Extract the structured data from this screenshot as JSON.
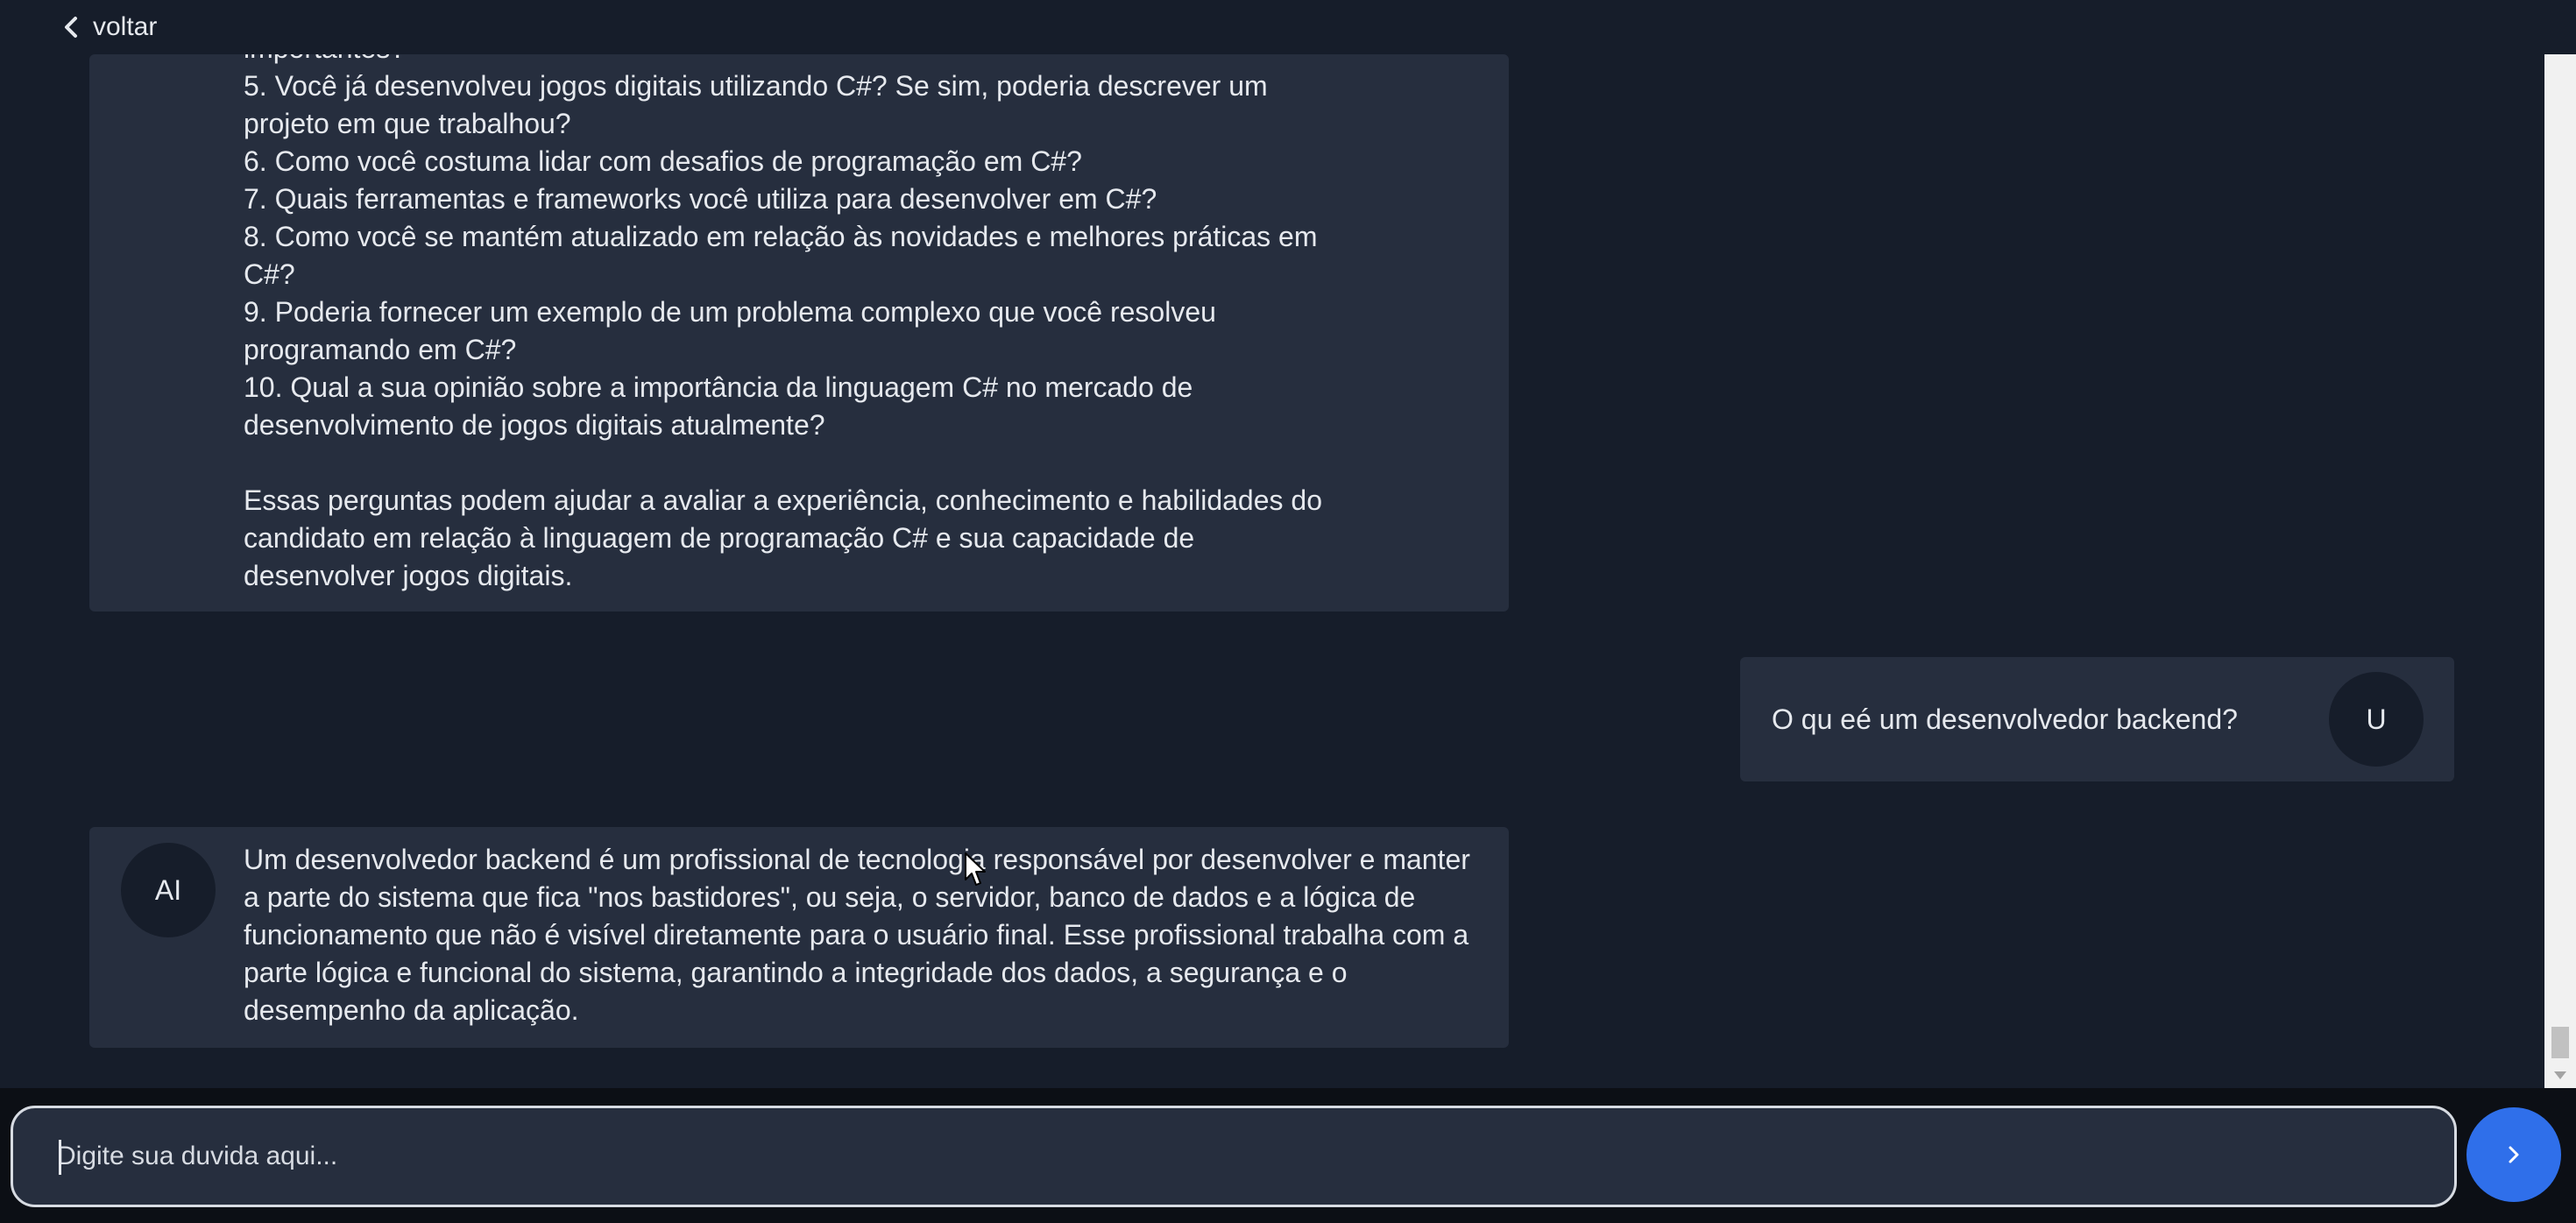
{
  "header": {
    "back_label": "voltar"
  },
  "messages": {
    "first_ai": {
      "lines": [
        "importantes?",
        "5. Você já desenvolveu jogos digitais utilizando C#? Se sim, poderia descrever um",
        "projeto em que trabalhou?",
        "6. Como você costuma lidar com desafios de programação em C#?",
        "7. Quais ferramentas e frameworks você utiliza para desenvolver em C#?",
        "8. Como você se mantém atualizado em relação às novidades e melhores práticas em",
        "C#?",
        "9. Poderia fornecer um exemplo de um problema complexo que você resolveu",
        "programando em C#?",
        "10. Qual a sua opinião sobre a importância da linguagem C# no mercado de",
        "desenvolvimento de jogos digitais atualmente?",
        "Essas perguntas podem ajudar a avaliar a experiência, conhecimento e habilidades do",
        "candidato em relação à linguagem de programação C# e sua capacidade de",
        "desenvolver jogos digitais."
      ]
    },
    "user": {
      "text": "O qu eé um desenvolvedor backend?",
      "avatar": "U"
    },
    "second_ai": {
      "avatar": "AI",
      "text": "Um desenvolvedor backend é um profissional de tecnologia responsável por desenvolver e manter a parte do sistema que fica \"nos bastidores\", ou seja, o servidor, banco de dados e a lógica de funcionamento que não é visível diretamente para o usuário final. Esse profissional trabalha com a parte lógica e funcional do sistema, garantindo a integridade dos dados, a segurança e o desempenho da aplicação."
    }
  },
  "composer": {
    "placeholder": "Digite sua duvida aqui...",
    "value": ""
  },
  "colors": {
    "background": "#161d2a",
    "bubble": "#262e3e",
    "send_button": "#2f6fea"
  }
}
